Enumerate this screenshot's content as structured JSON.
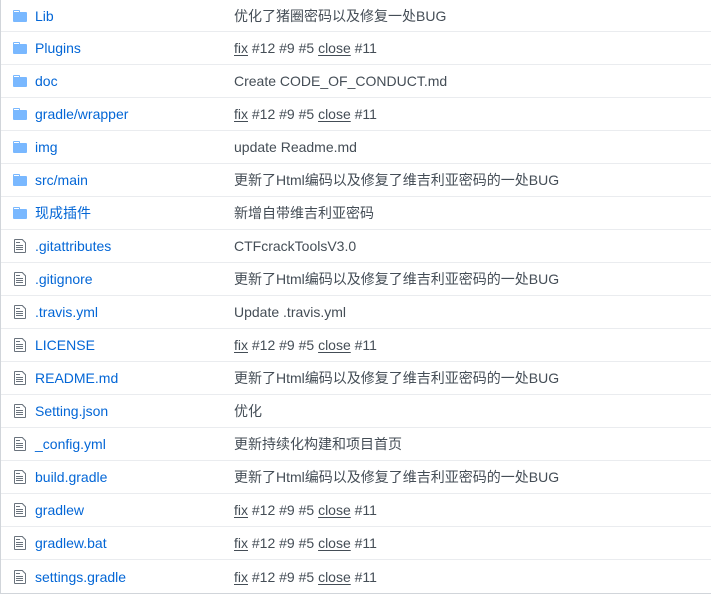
{
  "colors": {
    "folder_icon": "#79b8ff",
    "file_icon": "#6a737d",
    "link": "#0366d6",
    "message": "#444d56",
    "row_border": "#eaecef"
  },
  "rows": [
    {
      "type": "folder",
      "icon": "folder-icon",
      "name": "Lib",
      "message": [
        {
          "t": "优化了猪圈密码以及修复一处BUG",
          "link": false
        }
      ]
    },
    {
      "type": "folder",
      "icon": "folder-icon",
      "name": "Plugins",
      "message": [
        {
          "t": "fix",
          "link": true
        },
        {
          "t": " #12 #9 #5 ",
          "link": false
        },
        {
          "t": "close",
          "link": true
        },
        {
          "t": " #11",
          "link": false
        }
      ]
    },
    {
      "type": "folder",
      "icon": "folder-icon",
      "name": "doc",
      "message": [
        {
          "t": "Create CODE_OF_CONDUCT.md",
          "link": false
        }
      ]
    },
    {
      "type": "folder",
      "icon": "folder-icon",
      "name": "gradle/wrapper",
      "message": [
        {
          "t": "fix",
          "link": true
        },
        {
          "t": " #12 #9 #5 ",
          "link": false
        },
        {
          "t": "close",
          "link": true
        },
        {
          "t": " #11",
          "link": false
        }
      ]
    },
    {
      "type": "folder",
      "icon": "folder-icon",
      "name": "img",
      "message": [
        {
          "t": "update Readme.md",
          "link": false
        }
      ]
    },
    {
      "type": "folder",
      "icon": "folder-icon",
      "name": "src/main",
      "message": [
        {
          "t": "更新了Html编码以及修复了维吉利亚密码的一处BUG",
          "link": false
        }
      ]
    },
    {
      "type": "folder",
      "icon": "folder-icon",
      "name": "现成插件",
      "message": [
        {
          "t": "新增自带维吉利亚密码",
          "link": false
        }
      ]
    },
    {
      "type": "file",
      "icon": "file-icon",
      "name": ".gitattributes",
      "message": [
        {
          "t": "CTFcrackToolsV3.0",
          "link": false
        }
      ]
    },
    {
      "type": "file",
      "icon": "file-icon",
      "name": ".gitignore",
      "message": [
        {
          "t": "更新了Html编码以及修复了维吉利亚密码的一处BUG",
          "link": false
        }
      ]
    },
    {
      "type": "file",
      "icon": "file-icon",
      "name": ".travis.yml",
      "message": [
        {
          "t": "Update .travis.yml",
          "link": false
        }
      ]
    },
    {
      "type": "file",
      "icon": "file-icon",
      "name": "LICENSE",
      "message": [
        {
          "t": "fix",
          "link": true
        },
        {
          "t": " #12 #9 #5 ",
          "link": false
        },
        {
          "t": "close",
          "link": true
        },
        {
          "t": " #11",
          "link": false
        }
      ]
    },
    {
      "type": "file",
      "icon": "file-icon",
      "name": "README.md",
      "message": [
        {
          "t": "更新了Html编码以及修复了维吉利亚密码的一处BUG",
          "link": false
        }
      ]
    },
    {
      "type": "file",
      "icon": "file-icon",
      "name": "Setting.json",
      "message": [
        {
          "t": "优化",
          "link": false
        }
      ]
    },
    {
      "type": "file",
      "icon": "file-icon",
      "name": "_config.yml",
      "message": [
        {
          "t": "更新持续化构建和项目首页",
          "link": false
        }
      ]
    },
    {
      "type": "file",
      "icon": "file-icon",
      "name": "build.gradle",
      "message": [
        {
          "t": "更新了Html编码以及修复了维吉利亚密码的一处BUG",
          "link": false
        }
      ]
    },
    {
      "type": "file",
      "icon": "file-icon",
      "name": "gradlew",
      "message": [
        {
          "t": "fix",
          "link": true
        },
        {
          "t": " #12 #9 #5 ",
          "link": false
        },
        {
          "t": "close",
          "link": true
        },
        {
          "t": " #11",
          "link": false
        }
      ]
    },
    {
      "type": "file",
      "icon": "file-icon",
      "name": "gradlew.bat",
      "message": [
        {
          "t": "fix",
          "link": true
        },
        {
          "t": " #12 #9 #5 ",
          "link": false
        },
        {
          "t": "close",
          "link": true
        },
        {
          "t": " #11",
          "link": false
        }
      ]
    },
    {
      "type": "file",
      "icon": "file-icon",
      "name": "settings.gradle",
      "message": [
        {
          "t": "fix",
          "link": true
        },
        {
          "t": " #12 #9 #5 ",
          "link": false
        },
        {
          "t": "close",
          "link": true
        },
        {
          "t": " #11",
          "link": false
        }
      ]
    }
  ]
}
